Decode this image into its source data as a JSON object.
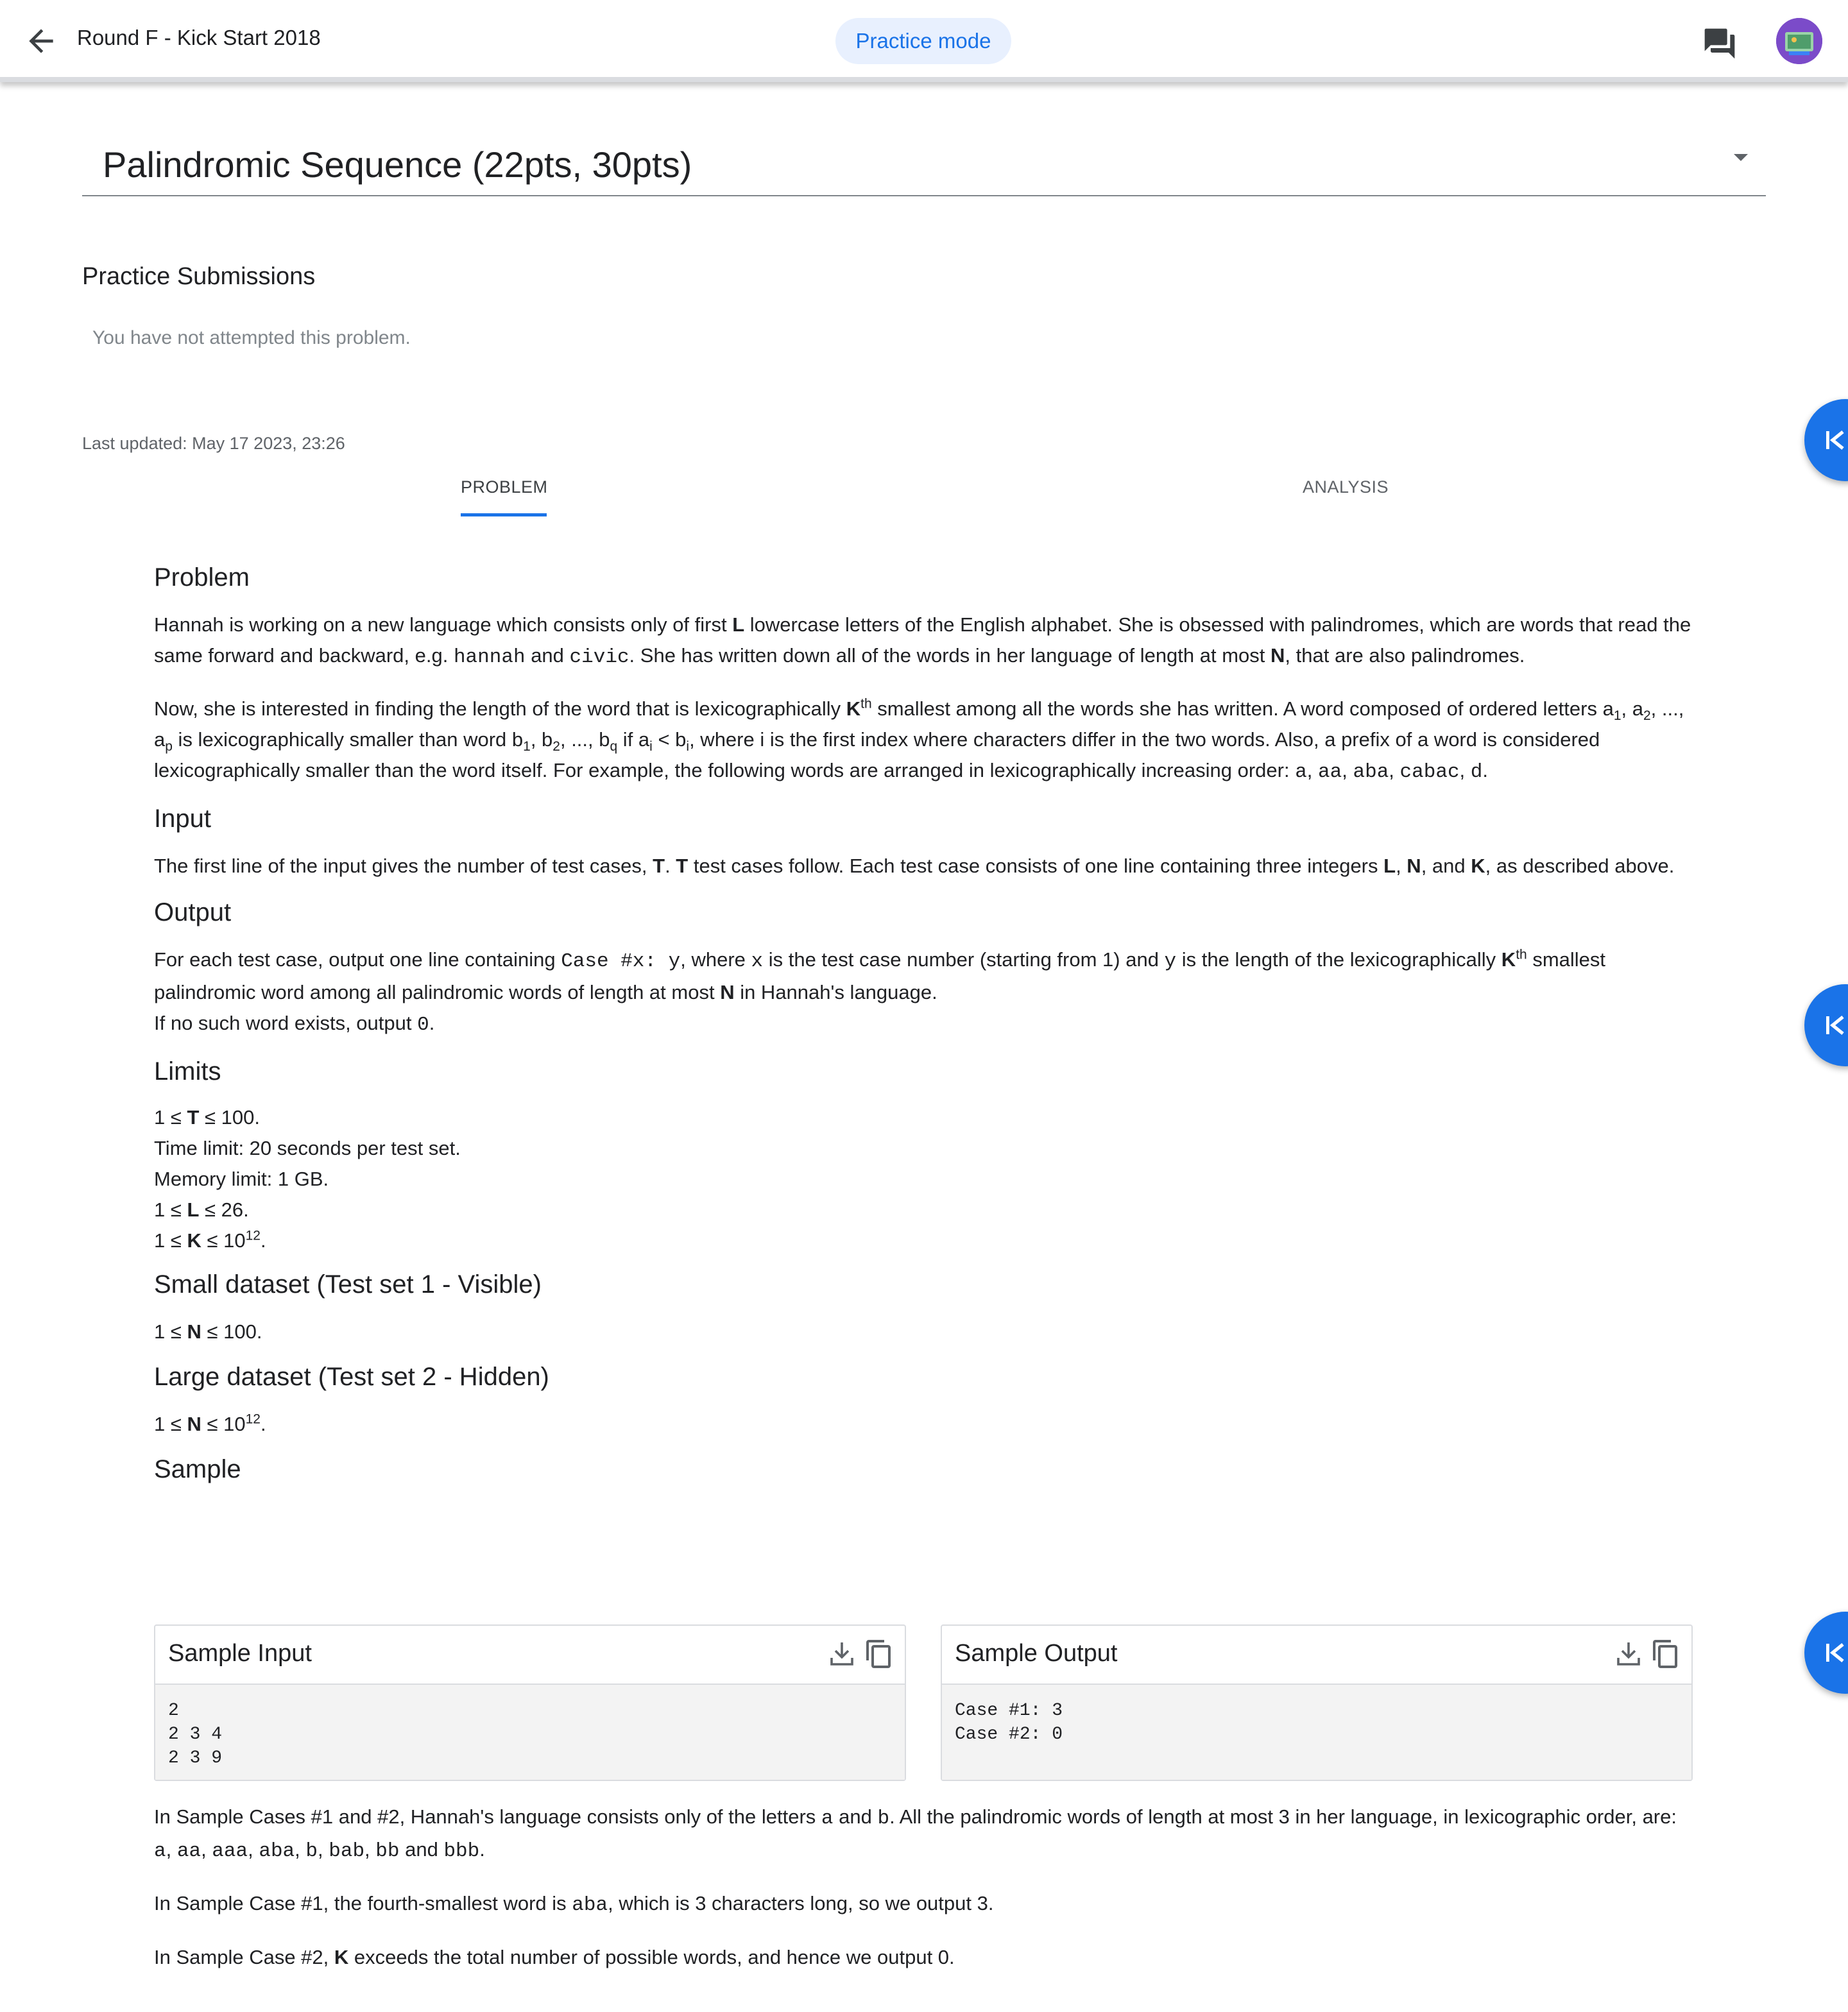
{
  "header": {
    "round_title": "Round F - Kick Start 2018",
    "mode_label": "Practice mode"
  },
  "problem_select": {
    "title": "Palindromic Sequence (22pts, 30pts)"
  },
  "submissions": {
    "title": "Practice Submissions",
    "empty_text": "You have not attempted this problem."
  },
  "last_updated": "Last updated: May 17 2023, 23:26",
  "tabs": [
    {
      "label": "PROBLEM",
      "active": true
    },
    {
      "label": "ANALYSIS",
      "active": false
    }
  ],
  "sections": {
    "problem_h": "Problem",
    "input_h": "Input",
    "output_h": "Output",
    "limits_h": "Limits",
    "small_h": "Small dataset (Test set 1 - Visible)",
    "large_h": "Large dataset (Test set 2 - Hidden)",
    "sample_h": "Sample"
  },
  "problem": {
    "p1": {
      "a": "Hannah is working on a new language which consists only of first ",
      "L": "L",
      "b": " lowercase letters of the English alphabet. She is obsessed with palindromes, which are words that read the same forward and backward, e.g. ",
      "hannah": "hannah",
      "and": " and ",
      "civic": "civic",
      "c": ". She has written down all of the words in her language of length at most ",
      "N": "N",
      "d": ", that are also palindromes."
    },
    "p2": {
      "a": "Now, she is interested in finding the length of the word that is lexicographically ",
      "K": "K",
      "th": "th",
      "b": " smallest among all the words she has written. A word composed of ordered letters a",
      "s1": "1",
      "c": ", a",
      "s2": "2",
      "d": ", ..., a",
      "sp": "p",
      "e": " is lexicographically smaller than word b",
      "t1": "1",
      "f": ", b",
      "t2": "2",
      "g": ", ..., b",
      "tq": "q",
      "h": " if a",
      "si": "i",
      "i": " < b",
      "ti": "i",
      "j": ", where i is the first index where characters differ in the two words. Also, a prefix of a word is considered lexicographically smaller than the word itself. For example, the following words are arranged in lexicographically increasing order: ",
      "w1": "a",
      "w2": "aa",
      "w3": "aba",
      "w4": "cabac",
      "w5": "d",
      "comma": ", ",
      "end": "."
    }
  },
  "input": {
    "a": "The first line of the input gives the number of test cases, ",
    "T": "T",
    "b": ". ",
    "T2": "T",
    "c": " test cases follow. Each test case consists of one line containing three integers ",
    "L": "L",
    "comma": ", ",
    "N": "N",
    "and": ", and ",
    "K": "K",
    "d": ", as described above."
  },
  "output": {
    "a": "For each test case, output one line containing ",
    "code": "Case #x: y",
    "b": ", where ",
    "x": "x",
    "c": " is the test case number (starting from 1) and ",
    "y": "y",
    "d": " is the length of the lexicographically ",
    "K": "K",
    "th": "th",
    "e": " smallest palindromic word among all palindromic words of length at most ",
    "N": "N",
    "f": " in Hannah's language.",
    "g": "If no such word exists, output ",
    "zero": "0",
    "h": "."
  },
  "limits": {
    "pre": "1 ≤ ",
    "T": "T",
    "t_post": " ≤ 100.",
    "time": "Time limit: 20 seconds per test set.",
    "memory": "Memory limit: 1 GB.",
    "L": "L",
    "l_post": " ≤ 26.",
    "K": "K",
    "k_post": " ≤ 10",
    "k_exp": "12",
    "dot": "."
  },
  "small": {
    "pre": "1 ≤ ",
    "N": "N",
    "post": " ≤ 100."
  },
  "large": {
    "pre": "1 ≤ ",
    "N": "N",
    "post": " ≤ 10",
    "exp": "12",
    "dot": "."
  },
  "samples": {
    "input_title": "Sample Input",
    "input_text": "2\n2 3 4\n2 3 9",
    "output_title": "Sample Output",
    "output_text": "Case #1: 3\nCase #2: 0"
  },
  "explanation": {
    "p1": {
      "a": "In Sample Cases #1 and #2, Hannah's language consists only of the letters ",
      "la": "a",
      "and": " and ",
      "lb": "b",
      "b": ". All the palindromic words of length at most 3 in her language, in lexicographic order, are: ",
      "w1": "a",
      "w2": "aa",
      "w3": "aaa",
      "w4": "aba",
      "w5": "b",
      "w6": "bab",
      "w7": "bb",
      "and2": " and ",
      "w8": "bbb",
      "comma": ", ",
      "end": "."
    },
    "p2": {
      "a": "In Sample Case #1, the fourth-smallest word is ",
      "aba": "aba",
      "b": ", which is 3 characters long, so we output 3."
    },
    "p3": {
      "a": "In Sample Case #2, ",
      "K": "K",
      "b": " exceeds the total number of possible words, and hence we output 0."
    }
  },
  "colors": {
    "accent": "#1a73e8",
    "chip_bg": "#e8f0fe",
    "muted_text": "#5f6368",
    "code_bg": "#f3f3f3"
  }
}
